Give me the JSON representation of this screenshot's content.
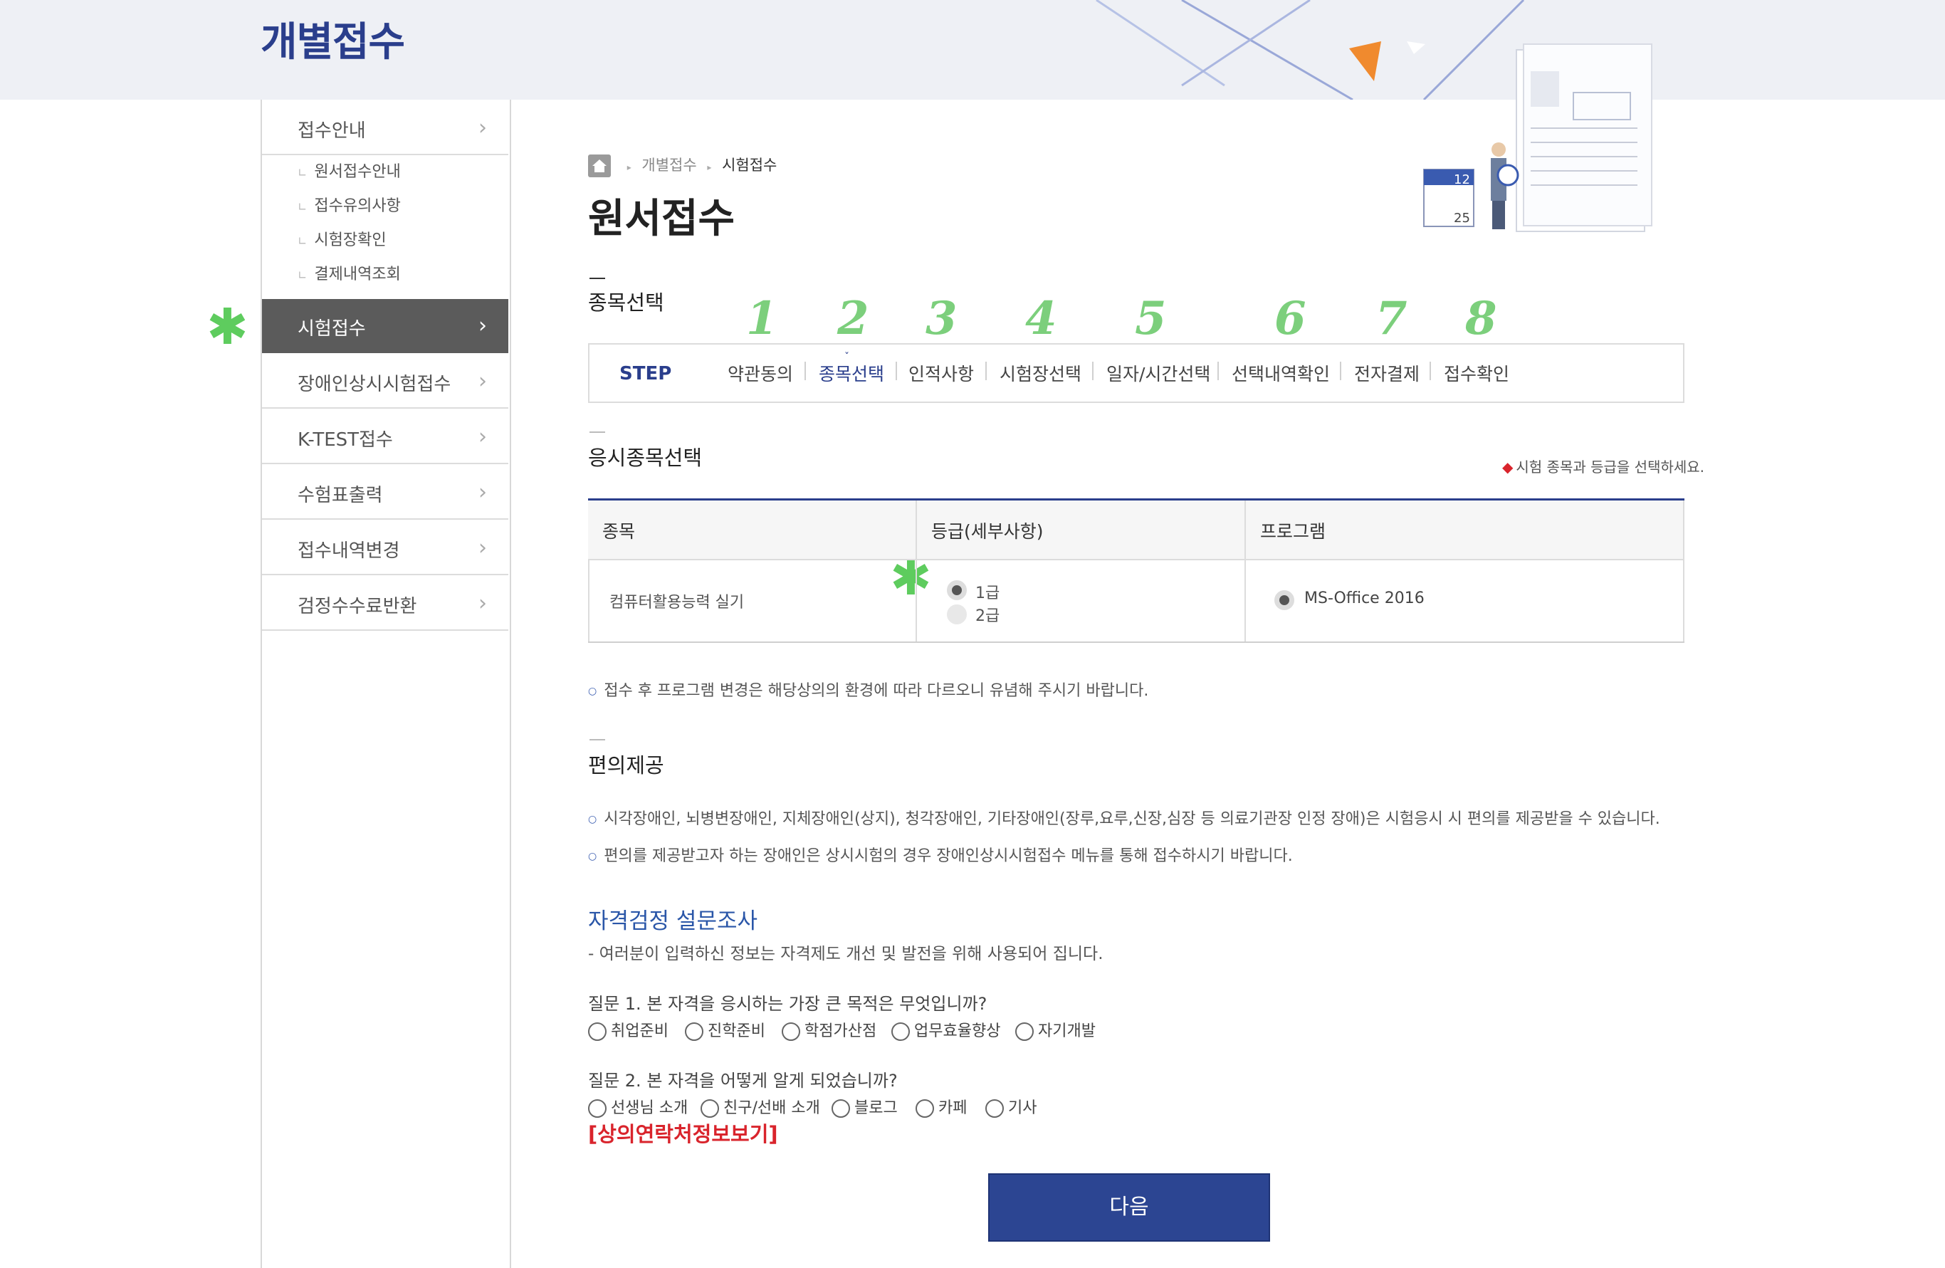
{
  "header": {
    "title": "개별접수"
  },
  "sidebar": {
    "items": [
      {
        "label": "접수안내"
      },
      {
        "label": "시험접수"
      },
      {
        "label": "장애인상시시험접수"
      },
      {
        "label": "K-TEST접수"
      },
      {
        "label": "수험표출력"
      },
      {
        "label": "접수내역변경"
      },
      {
        "label": "검정수수료반환"
      }
    ],
    "subitems": [
      {
        "label": "원서접수안내"
      },
      {
        "label": "접수유의사항"
      },
      {
        "label": "시험장확인"
      },
      {
        "label": "결제내역조회"
      }
    ]
  },
  "breadcrumb": {
    "parent": "개별접수",
    "current": "시험접수"
  },
  "page": {
    "title": "원서접수"
  },
  "steps": {
    "section_title": "종목선택",
    "label": "STEP",
    "items": [
      {
        "num": "1",
        "label": "약관동의"
      },
      {
        "num": "2",
        "label": "종목선택"
      },
      {
        "num": "3",
        "label": "인적사항"
      },
      {
        "num": "4",
        "label": "시험장선택"
      },
      {
        "num": "5",
        "label": "일자/시간선택"
      },
      {
        "num": "6",
        "label": "선택내역확인"
      },
      {
        "num": "7",
        "label": "전자결제"
      },
      {
        "num": "8",
        "label": "접수확인"
      }
    ]
  },
  "exam": {
    "section_title": "응시종목선택",
    "hint": "시험 종목과 등급을 선택하세요.",
    "headers": {
      "subject": "종목",
      "grade": "등급(세부사항)",
      "program": "프로그램"
    },
    "row": {
      "subject": "컴퓨터활용능력 실기",
      "grades": [
        {
          "label": "1급",
          "selected": true
        },
        {
          "label": "2급",
          "selected": false
        }
      ],
      "program": {
        "label": "MS-Office 2016",
        "selected": true
      }
    },
    "note": "접수 후 프로그램 변경은 해당상의의 환경에 따라 다르오니 유념해 주시기 바랍니다."
  },
  "convenience": {
    "section_title": "편의제공",
    "notes": [
      "시각장애인, 뇌병변장애인, 지체장애인(상지), 청각장애인, 기타장애인(장루,요루,신장,심장 등 의료기관장 인정 장애)은 시험응시 시 편의를 제공받을 수 있습니다.",
      "편의를 제공받고자 하는 장애인은 상시시험의 경우 장애인상시시험접수 메뉴를 통해 접수하시기 바랍니다."
    ]
  },
  "survey": {
    "title": "자격검정 설문조사",
    "description": "- 여러분이 입력하신 정보는 자격제도 개선 및 발전을 위해 사용되어 집니다.",
    "q1": {
      "question": "질문 1. 본 자격을 응시하는 가장 큰 목적은 무엇입니까?",
      "options": [
        "취업준비",
        "진학준비",
        "학점가산점",
        "업무효율향상",
        "자기개발"
      ]
    },
    "q2": {
      "question": "질문 2. 본 자격을 어떻게 알게 되었습니까?",
      "options": [
        "선생님 소개",
        "친구/선배 소개",
        "블로그",
        "카페",
        "기사"
      ]
    }
  },
  "contact_link": "[상의연락처정보보기]",
  "next_button": "다음",
  "annotations": {
    "star_color": "#5ecc5e"
  },
  "colors": {
    "brand": "#2a3e8c",
    "button": "#2c4592",
    "active_menu": "#5b5b5b",
    "link_red": "#d9242c"
  }
}
